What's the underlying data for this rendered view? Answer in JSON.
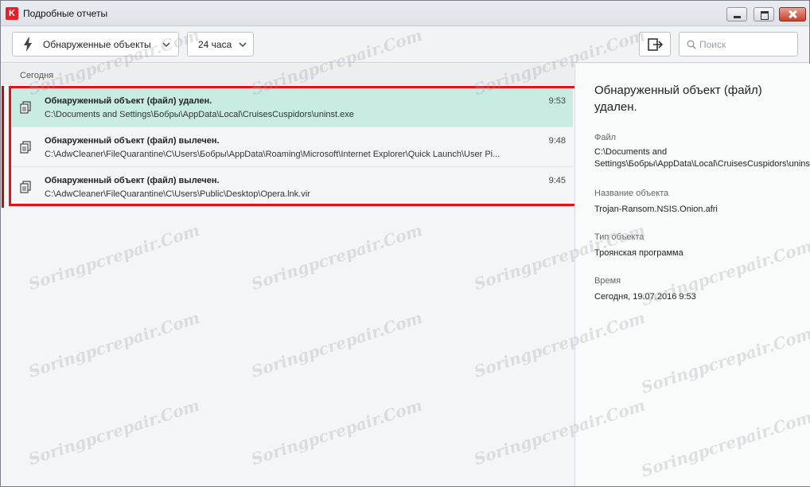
{
  "window": {
    "title": "Подробные отчеты",
    "logo_letter": "K"
  },
  "toolbar": {
    "filter_label": "Обнаруженные объекты",
    "period_label": "24 часа",
    "search_placeholder": "Поиск"
  },
  "list": {
    "section_label": "Сегодня",
    "events": [
      {
        "title": "Обнаруженный объект (файл) удален.",
        "path": "C:\\Documents and Settings\\Бобры\\AppData\\Local\\CruisesCuspidors\\uninst.exe",
        "time": "9:53"
      },
      {
        "title": "Обнаруженный объект (файл) вылечен.",
        "path": "C:\\AdwCleaner\\FileQuarantine\\C\\Users\\Бобры\\AppData\\Roaming\\Microsoft\\Internet Explorer\\Quick Launch\\User Pi...",
        "time": "9:48"
      },
      {
        "title": "Обнаруженный объект (файл) вылечен.",
        "path": "C:\\AdwCleaner\\FileQuarantine\\C\\Users\\Public\\Desktop\\Opera.lnk.vir",
        "time": "9:45"
      }
    ]
  },
  "details": {
    "title": "Обнаруженный объект (файл) удален.",
    "file_label": "Файл",
    "file_value": "C:\\Documents and Settings\\Бобры\\AppData\\Local\\CruisesCuspidors\\uninst.exe",
    "name_label": "Название объекта",
    "name_value": "Trojan-Ransom.NSIS.Onion.afri",
    "type_label": "Тип объекта",
    "type_value": "Троянская программа",
    "time_label": "Время",
    "time_value": "Сегодня, 19.07.2016 9:53"
  },
  "watermark": "Soringpcrepair.Com",
  "colors": {
    "selected_row": "#c8ebe2",
    "highlight_border": "#e0131b",
    "close_button": "#c7412b",
    "logo": "#e4202a"
  },
  "icons": {
    "filter": "lightning-icon",
    "dropdown": "chevron-down-icon",
    "export": "export-icon",
    "search": "search-icon",
    "event": "document-copies-icon"
  }
}
